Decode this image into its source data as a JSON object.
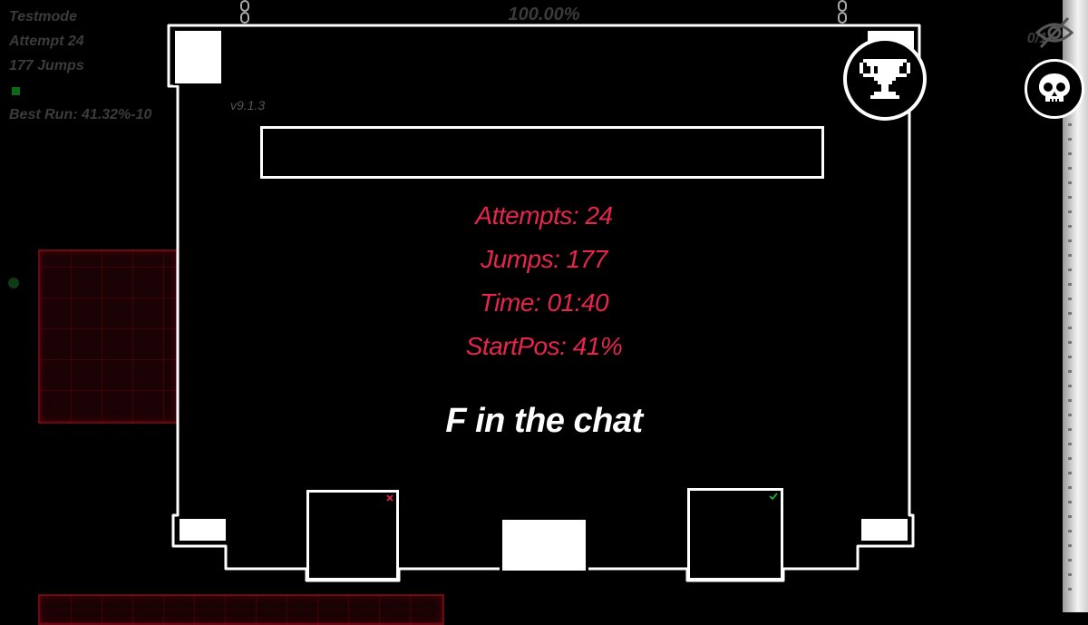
{
  "hud": {
    "mode": "Testmode",
    "attempt": "Attempt 24",
    "jumps": "177 Jumps",
    "best_run": "Best Run: 41.32%-10"
  },
  "progress": "100.00%",
  "corner_counter": "0/1",
  "version": "v9.1.3",
  "stats": {
    "attempts": "Attempts: 24",
    "jumps": "Jumps: 177",
    "time": "Time: 01:40",
    "startpos": "StartPos: 41%"
  },
  "message": "F in the chat",
  "icons": {
    "trophy": "trophy-icon",
    "skull": "skull-icon",
    "eye": "eye-hidden-icon",
    "close": "close-icon",
    "check": "check-icon"
  },
  "colors": {
    "stat_text": "#e8254a",
    "background": "#000000",
    "panel_outline": "#ffffff",
    "hud_text": "#3b3b3b",
    "accent_green": "#1fae3a"
  }
}
